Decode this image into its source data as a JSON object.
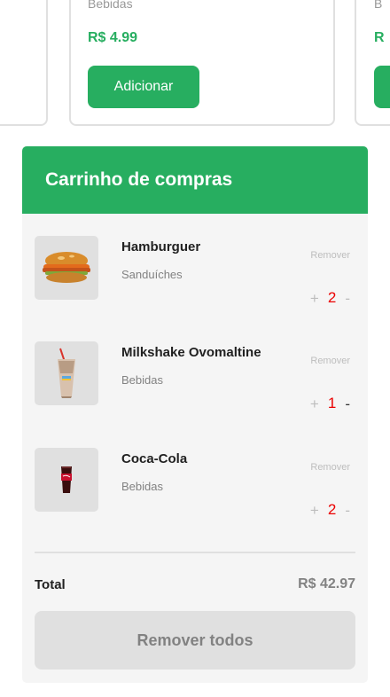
{
  "products": {
    "center": {
      "category": "Bebidas",
      "price": "R$ 4.99",
      "add_label": "Adicionar"
    },
    "right": {
      "category": "B",
      "price": "R",
      "add_label": ""
    }
  },
  "cart": {
    "title": "Carrinho de compras",
    "items": [
      {
        "name": "Hamburguer",
        "category": "Sanduíches",
        "remove_label": "Remover",
        "quantity": "2",
        "plus": "+",
        "minus": "-",
        "icon": "hamburger-image"
      },
      {
        "name": "Milkshake Ovomaltine",
        "category": "Bebidas",
        "remove_label": "Remover",
        "quantity": "1",
        "plus": "+",
        "minus": "-",
        "icon": "milkshake-image"
      },
      {
        "name": "Coca-Cola",
        "category": "Bebidas",
        "remove_label": "Remover",
        "quantity": "2",
        "plus": "+",
        "minus": "-",
        "icon": "coca-cola-image"
      }
    ],
    "total_label": "Total",
    "total_value": "R$ 42.97",
    "remove_all_label": "Remover todos"
  },
  "colors": {
    "brand_green": "#27ae60",
    "quantity_red": "#eb0000",
    "muted_gray": "#828282"
  }
}
